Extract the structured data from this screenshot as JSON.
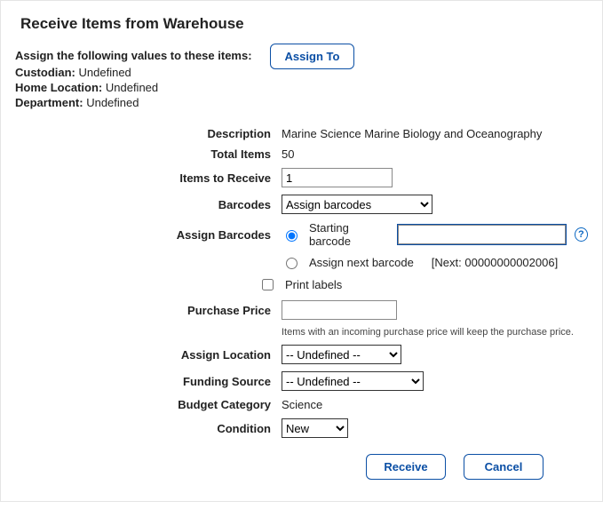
{
  "title": "Receive Items from Warehouse",
  "assignTo": {
    "button": "Assign To",
    "heading": "Assign the following values to these items:"
  },
  "meta": {
    "custodian": {
      "label": "Custodian:",
      "value": "Undefined"
    },
    "homeLocation": {
      "label": "Home Location:",
      "value": "Undefined"
    },
    "department": {
      "label": "Department:",
      "value": "Undefined"
    }
  },
  "form": {
    "description": {
      "label": "Description",
      "value": "Marine Science Marine Biology and Oceanography"
    },
    "totalItems": {
      "label": "Total Items",
      "value": "50"
    },
    "itemsToReceive": {
      "label": "Items to Receive",
      "value": "1"
    },
    "barcodes": {
      "label": "Barcodes",
      "selected": "Assign barcodes"
    },
    "assignBarcodes": {
      "label": "Assign Barcodes",
      "starting": {
        "label": "Starting barcode",
        "value": ""
      },
      "assignNext": {
        "label": "Assign next barcode",
        "nextText": "[Next: 00000000002006]"
      }
    },
    "printLabels": {
      "label": "Print labels",
      "checked": false
    },
    "purchasePrice": {
      "label": "Purchase Price",
      "value": "",
      "hint": "Items with an incoming purchase price will keep the purchase price."
    },
    "assignLocation": {
      "label": "Assign Location",
      "selected": "-- Undefined --"
    },
    "fundingSource": {
      "label": "Funding Source",
      "selected": "-- Undefined --"
    },
    "budgetCategory": {
      "label": "Budget Category",
      "value": "Science"
    },
    "condition": {
      "label": "Condition",
      "selected": "New"
    }
  },
  "actions": {
    "receive": "Receive",
    "cancel": "Cancel"
  }
}
